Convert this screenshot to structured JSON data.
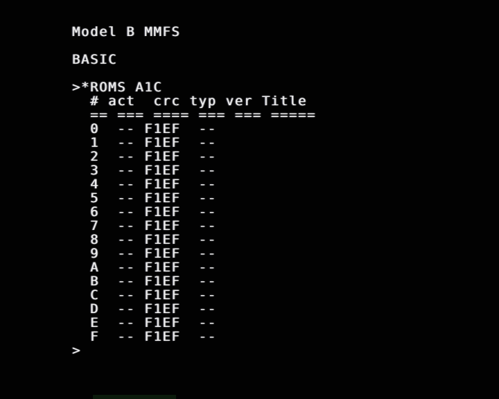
{
  "terminal": {
    "machine_line": "Model B MMFS",
    "language_line": "BASIC",
    "command_line": ">*ROMS A1C",
    "header_line": "  # act  crc typ ver Title",
    "separator_line": "  == === ==== === === =====",
    "rom_rows": [
      "  0  -- F1EF  --",
      "  1  -- F1EF  --",
      "  2  -- F1EF  --",
      "  3  -- F1EF  --",
      "  4  -- F1EF  --",
      "  5  -- F1EF  --",
      "  6  -- F1EF  --",
      "  7  -- F1EF  --",
      "  8  -- F1EF  --",
      "  9  -- F1EF  --",
      "  A  -- F1EF  --",
      "  B  -- F1EF  --",
      "  C  -- F1EF  --",
      "  D  -- F1EF  --",
      "  E  -- F1EF  --",
      "  F  -- F1EF  --"
    ],
    "prompt": ">",
    "colors": {
      "background": "#020202",
      "text": "#eeeeee"
    }
  }
}
